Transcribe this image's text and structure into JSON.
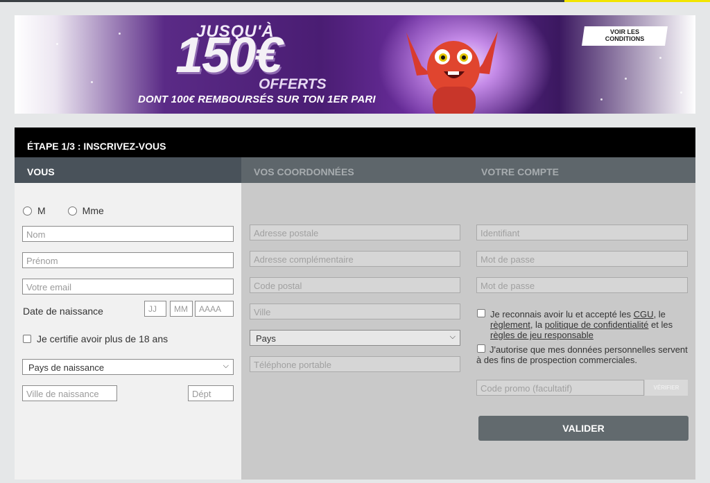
{
  "banner": {
    "headline_prefix": "JUSQU'À",
    "headline_amount": "150€",
    "headline_suffix": "OFFERTS",
    "subline": "DONT 100€ REMBOURSÉS SUR TON 1ER PARI",
    "conditions_button": "VOIR LES CONDITIONS",
    "mascot": "red-mascot-character"
  },
  "form": {
    "step_title": "ÉTAPE 1/3 : INSCRIVEZ-VOUS",
    "tabs": [
      {
        "label": "VOUS",
        "active": true
      },
      {
        "label": "VOS COORDONNÉES",
        "active": false
      },
      {
        "label": "VOTRE COMPTE",
        "active": false
      }
    ],
    "vous": {
      "civility": [
        {
          "label": "M",
          "checked": false
        },
        {
          "label": "Mme",
          "checked": false
        }
      ],
      "nom_placeholder": "Nom",
      "prenom_placeholder": "Prénom",
      "email_placeholder": "Votre email",
      "birthdate_label": "Date de naissance",
      "day_placeholder": "JJ",
      "month_placeholder": "MM",
      "year_placeholder": "AAAA",
      "age_checkbox": "Je certifie avoir plus de 18 ans",
      "birth_country_select": "Pays de naissance",
      "birth_city_placeholder": "Ville de naissance",
      "dept_placeholder": "Dépt"
    },
    "coordonnees": {
      "address_placeholder": "Adresse postale",
      "address2_placeholder": "Adresse complémentaire",
      "zip_placeholder": "Code postal",
      "city_placeholder": "Ville",
      "country_select": "Pays",
      "phone_placeholder": "Téléphone portable"
    },
    "compte": {
      "username_placeholder": "Identifiant",
      "password_placeholder": "Mot de passe",
      "password_confirm_placeholder": "Mot de passe",
      "terms": {
        "t1": "Je reconnais avoir lu et accepté les ",
        "cgu": "CGU",
        "t2": ", le ",
        "reglement": "règlement",
        "t3": ", la ",
        "privacy": "politique de confidentialité",
        "t4": " et les ",
        "responsible": "règles de jeu responsable"
      },
      "marketing_consent": "J'autorise que mes données personnelles servent à des fins de prospection commerciales.",
      "promo_placeholder": "Code promo (facultatif)",
      "verify_button": "VÉRIFIER",
      "submit_button": "VALIDER"
    }
  },
  "colors": {
    "header_bg": "#000000",
    "tabs_bg": "#5e666b",
    "active_tab_bg": "#49525a",
    "panel_bg": "#c9c9c9",
    "active_panel_bg": "#f1f1f1",
    "submit_bg": "#626a6e",
    "accent_yellow": "#f2e500"
  }
}
